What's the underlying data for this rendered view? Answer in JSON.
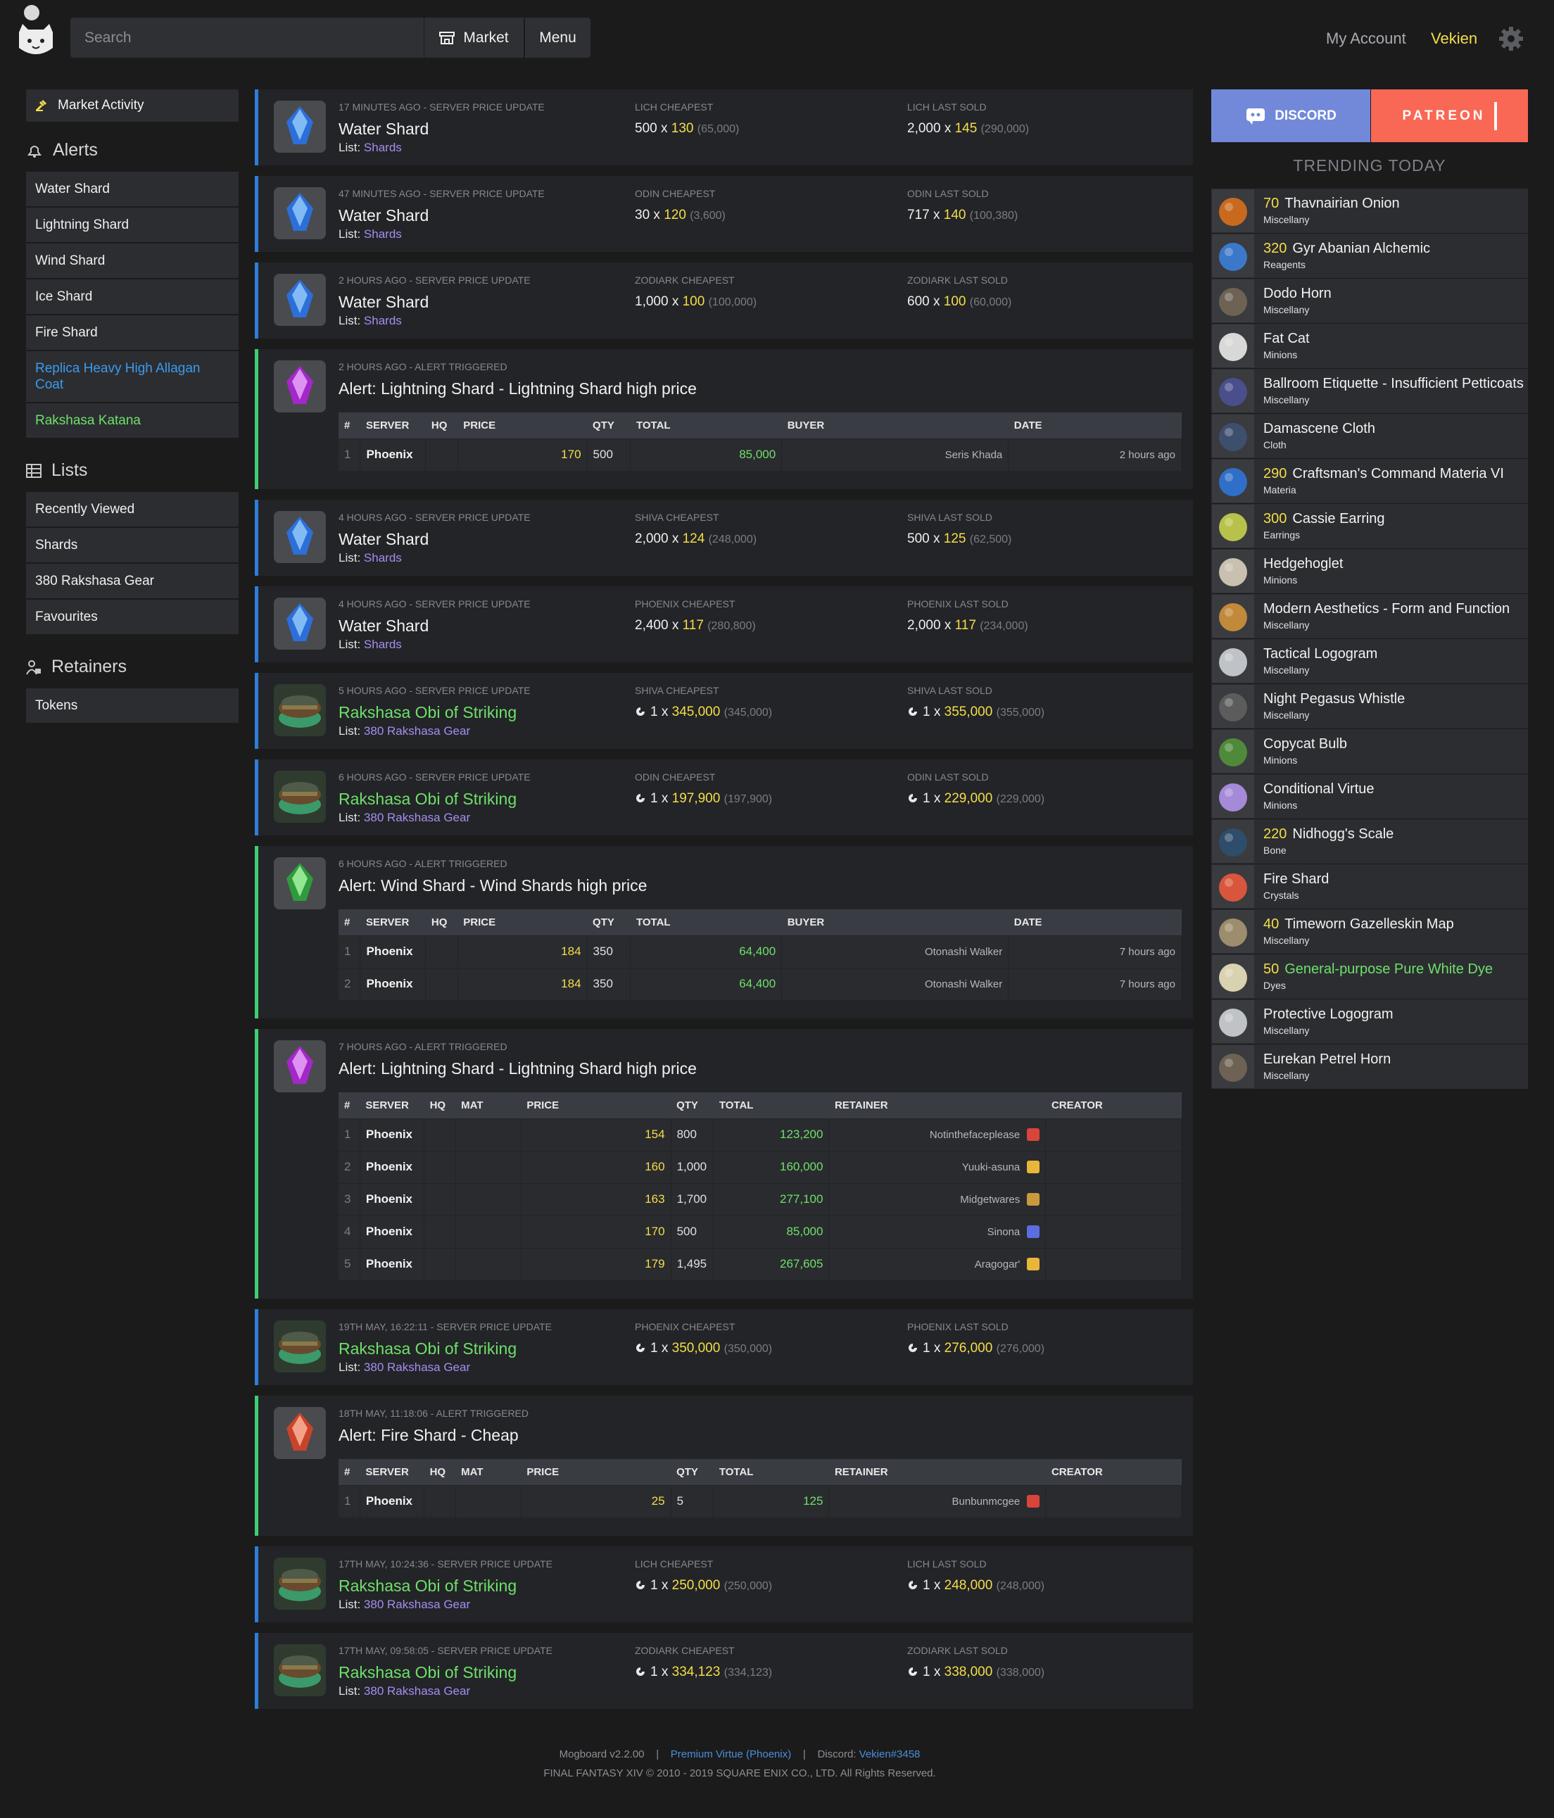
{
  "header": {
    "search_placeholder": "Search",
    "market_label": "Market",
    "menu_label": "Menu",
    "account_label": "My Account",
    "username": "Vekien"
  },
  "sidebar": {
    "market_activity": "Market Activity",
    "alerts_heading": "Alerts",
    "alerts": [
      {
        "label": "Water Shard",
        "color": "#f0f0f0"
      },
      {
        "label": "Lightning Shard",
        "color": "#f0f0f0"
      },
      {
        "label": "Wind Shard",
        "color": "#f0f0f0"
      },
      {
        "label": "Ice Shard",
        "color": "#f0f0f0"
      },
      {
        "label": "Fire Shard",
        "color": "#f0f0f0"
      },
      {
        "label": "Replica Heavy High Allagan Coat",
        "color": "#3a9bf0"
      },
      {
        "label": "Rakshasa Katana",
        "color": "#6ee06b"
      }
    ],
    "lists_heading": "Lists",
    "lists": [
      "Recently Viewed",
      "Shards",
      "380 Rakshasa Gear",
      "Favourites"
    ],
    "retainers_heading": "Retainers",
    "retainers": [
      "Tokens"
    ]
  },
  "feed": [
    {
      "type": "price",
      "icon": "water-shard",
      "meta": "17 MINUTES AGO - SERVER PRICE UPDATE",
      "title": "Water Shard",
      "green": false,
      "list_prefix": "List:",
      "list": "Shards",
      "c1_label": "LICH CHEAPEST",
      "c1_qty": "500",
      "c1_price": "130",
      "c1_total": "(65,000)",
      "c2_label": "LICH LAST SOLD",
      "c2_qty": "2,000",
      "c2_price": "145",
      "c2_total": "(290,000)",
      "hq": false
    },
    {
      "type": "price",
      "icon": "water-shard",
      "meta": "47 MINUTES AGO - SERVER PRICE UPDATE",
      "title": "Water Shard",
      "green": false,
      "list_prefix": "List:",
      "list": "Shards",
      "c1_label": "ODIN CHEAPEST",
      "c1_qty": "30",
      "c1_price": "120",
      "c1_total": "(3,600)",
      "c2_label": "ODIN LAST SOLD",
      "c2_qty": "717",
      "c2_price": "140",
      "c2_total": "(100,380)",
      "hq": false
    },
    {
      "type": "price",
      "icon": "water-shard",
      "meta": "2 HOURS AGO - SERVER PRICE UPDATE",
      "title": "Water Shard",
      "green": false,
      "list_prefix": "List:",
      "list": "Shards",
      "c1_label": "ZODIARK CHEAPEST",
      "c1_qty": "1,000",
      "c1_price": "100",
      "c1_total": "(100,000)",
      "c2_label": "ZODIARK LAST SOLD",
      "c2_qty": "600",
      "c2_price": "100",
      "c2_total": "(60,000)",
      "hq": false
    },
    {
      "type": "alert",
      "icon": "lightning-shard",
      "meta": "2 HOURS AGO - ALERT TRIGGERED",
      "title": "Alert: Lightning Shard - Lightning Shard high price",
      "kind": "sold",
      "headers": [
        "#",
        "SERVER",
        "HQ",
        "PRICE",
        "QTY",
        "TOTAL",
        "BUYER",
        "DATE"
      ],
      "rows": [
        [
          "1",
          "Phoenix",
          "",
          "170",
          "500",
          "85,000",
          "Seris Khada",
          "2 hours ago"
        ]
      ]
    },
    {
      "type": "price",
      "icon": "water-shard",
      "meta": "4 HOURS AGO - SERVER PRICE UPDATE",
      "title": "Water Shard",
      "green": false,
      "list_prefix": "List:",
      "list": "Shards",
      "c1_label": "SHIVA CHEAPEST",
      "c1_qty": "2,000",
      "c1_price": "124",
      "c1_total": "(248,000)",
      "c2_label": "SHIVA LAST SOLD",
      "c2_qty": "500",
      "c2_price": "125",
      "c2_total": "(62,500)",
      "hq": false
    },
    {
      "type": "price",
      "icon": "water-shard",
      "meta": "4 HOURS AGO - SERVER PRICE UPDATE",
      "title": "Water Shard",
      "green": false,
      "list_prefix": "List:",
      "list": "Shards",
      "c1_label": "PHOENIX CHEAPEST",
      "c1_qty": "2,400",
      "c1_price": "117",
      "c1_total": "(280,800)",
      "c2_label": "PHOENIX LAST SOLD",
      "c2_qty": "2,000",
      "c2_price": "117",
      "c2_total": "(234,000)",
      "hq": false
    },
    {
      "type": "price",
      "icon": "rakshasa-obi",
      "meta": "5 HOURS AGO - SERVER PRICE UPDATE",
      "title": "Rakshasa Obi of Striking",
      "green": true,
      "list_prefix": "List:",
      "list": "380 Rakshasa Gear",
      "c1_label": "SHIVA CHEAPEST",
      "c1_qty": "1",
      "c1_price": "345,000",
      "c1_total": "(345,000)",
      "c2_label": "SHIVA LAST SOLD",
      "c2_qty": "1",
      "c2_price": "355,000",
      "c2_total": "(355,000)",
      "hq": true
    },
    {
      "type": "price",
      "icon": "rakshasa-obi",
      "meta": "6 HOURS AGO - SERVER PRICE UPDATE",
      "title": "Rakshasa Obi of Striking",
      "green": true,
      "list_prefix": "List:",
      "list": "380 Rakshasa Gear",
      "c1_label": "ODIN CHEAPEST",
      "c1_qty": "1",
      "c1_price": "197,900",
      "c1_total": "(197,900)",
      "c2_label": "ODIN LAST SOLD",
      "c2_qty": "1",
      "c2_price": "229,000",
      "c2_total": "(229,000)",
      "hq": true
    },
    {
      "type": "alert",
      "icon": "wind-shard",
      "meta": "6 HOURS AGO - ALERT TRIGGERED",
      "title": "Alert: Wind Shard - Wind Shards high price",
      "kind": "sold",
      "headers": [
        "#",
        "SERVER",
        "HQ",
        "PRICE",
        "QTY",
        "TOTAL",
        "BUYER",
        "DATE"
      ],
      "rows": [
        [
          "1",
          "Phoenix",
          "",
          "184",
          "350",
          "64,400",
          "Otonashi Walker",
          "7 hours ago"
        ],
        [
          "2",
          "Phoenix",
          "",
          "184",
          "350",
          "64,400",
          "Otonashi Walker",
          "7 hours ago"
        ]
      ]
    },
    {
      "type": "alert",
      "icon": "lightning-shard",
      "meta": "7 HOURS AGO - ALERT TRIGGERED",
      "title": "Alert: Lightning Shard - Lightning Shard high price",
      "kind": "listing",
      "headers": [
        "#",
        "SERVER",
        "HQ",
        "MAT",
        "PRICE",
        "QTY",
        "TOTAL",
        "RETAINER",
        "CREATOR"
      ],
      "rows": [
        [
          "1",
          "Phoenix",
          "",
          "",
          "154",
          "800",
          "123,200",
          "Notinthefaceplease",
          "#d9453b",
          ""
        ],
        [
          "2",
          "Phoenix",
          "",
          "",
          "160",
          "1,000",
          "160,000",
          "Yuuki-asuna",
          "#e8b73a",
          ""
        ],
        [
          "3",
          "Phoenix",
          "",
          "",
          "163",
          "1,700",
          "277,100",
          "Midgetwares",
          "#c89a3c",
          ""
        ],
        [
          "4",
          "Phoenix",
          "",
          "",
          "170",
          "500",
          "85,000",
          "Sinona",
          "#5b6ee0",
          ""
        ],
        [
          "5",
          "Phoenix",
          "",
          "",
          "179",
          "1,495",
          "267,605",
          "Aragogar'",
          "#e8b73a",
          ""
        ]
      ]
    },
    {
      "type": "price",
      "icon": "rakshasa-obi",
      "meta": "19TH MAY, 16:22:11 - SERVER PRICE UPDATE",
      "title": "Rakshasa Obi of Striking",
      "green": true,
      "list_prefix": "List:",
      "list": "380 Rakshasa Gear",
      "c1_label": "PHOENIX CHEAPEST",
      "c1_qty": "1",
      "c1_price": "350,000",
      "c1_total": "(350,000)",
      "c2_label": "PHOENIX LAST SOLD",
      "c2_qty": "1",
      "c2_price": "276,000",
      "c2_total": "(276,000)",
      "hq": true
    },
    {
      "type": "alert",
      "icon": "fire-shard",
      "meta": "18TH MAY, 11:18:06 - ALERT TRIGGERED",
      "title": "Alert: Fire Shard - Cheap",
      "kind": "listing",
      "headers": [
        "#",
        "SERVER",
        "HQ",
        "MAT",
        "PRICE",
        "QTY",
        "TOTAL",
        "RETAINER",
        "CREATOR"
      ],
      "rows": [
        [
          "1",
          "Phoenix",
          "",
          "",
          "25",
          "5",
          "125",
          "Bunbunmcgee",
          "#d9453b",
          ""
        ]
      ]
    },
    {
      "type": "price",
      "icon": "rakshasa-obi",
      "meta": "17TH MAY, 10:24:36 - SERVER PRICE UPDATE",
      "title": "Rakshasa Obi of Striking",
      "green": true,
      "list_prefix": "List:",
      "list": "380 Rakshasa Gear",
      "c1_label": "LICH CHEAPEST",
      "c1_qty": "1",
      "c1_price": "250,000",
      "c1_total": "(250,000)",
      "c2_label": "LICH LAST SOLD",
      "c2_qty": "1",
      "c2_price": "248,000",
      "c2_total": "(248,000)",
      "hq": true
    },
    {
      "type": "price",
      "icon": "rakshasa-obi",
      "meta": "17TH MAY, 09:58:05 - SERVER PRICE UPDATE",
      "title": "Rakshasa Obi of Striking",
      "green": true,
      "list_prefix": "List:",
      "list": "380 Rakshasa Gear",
      "c1_label": "ZODIARK CHEAPEST",
      "c1_qty": "1",
      "c1_price": "334,123",
      "c1_total": "(334,123)",
      "c2_label": "ZODIARK LAST SOLD",
      "c2_qty": "1",
      "c2_price": "338,000",
      "c2_total": "(338,000)",
      "hq": true
    }
  ],
  "right": {
    "discord_label": "DISCORD",
    "patreon_label": "PATREON",
    "trending_heading": "TRENDING TODAY",
    "trending": [
      {
        "level": "70",
        "name": "Thavnairian Onion",
        "category": "Miscellany",
        "icon_color": "#c86a1e",
        "green": false
      },
      {
        "level": "320",
        "name": "Gyr Abanian Alchemic",
        "category": "Reagents",
        "icon_color": "#3b78c9",
        "green": false
      },
      {
        "level": "",
        "name": "Dodo Horn",
        "category": "Miscellany",
        "icon_color": "#6e6254",
        "green": false
      },
      {
        "level": "",
        "name": "Fat Cat",
        "category": "Minions",
        "icon_color": "#d8d8d8",
        "green": false
      },
      {
        "level": "",
        "name": "Ballroom Etiquette - Insufficient Petticoats",
        "category": "Miscellany",
        "icon_color": "#4a4f8c",
        "green": false
      },
      {
        "level": "",
        "name": "Damascene Cloth",
        "category": "Cloth",
        "icon_color": "#3e4f6e",
        "green": false
      },
      {
        "level": "290",
        "name": "Craftsman's Command Materia VI",
        "category": "Materia",
        "icon_color": "#2f6fc7",
        "green": false
      },
      {
        "level": "300",
        "name": "Cassie Earring",
        "category": "Earrings",
        "icon_color": "#b8c24a",
        "green": false
      },
      {
        "level": "",
        "name": "Hedgehoglet",
        "category": "Minions",
        "icon_color": "#c9c0b0",
        "green": false
      },
      {
        "level": "",
        "name": "Modern Aesthetics - Form and Function",
        "category": "Miscellany",
        "icon_color": "#c08a3a",
        "green": false
      },
      {
        "level": "",
        "name": "Tactical Logogram",
        "category": "Miscellany",
        "icon_color": "#bfc3c8",
        "green": false
      },
      {
        "level": "",
        "name": "Night Pegasus Whistle",
        "category": "Miscellany",
        "icon_color": "#5c5c5c",
        "green": false
      },
      {
        "level": "",
        "name": "Copycat Bulb",
        "category": "Minions",
        "icon_color": "#4f8a3a",
        "green": false
      },
      {
        "level": "",
        "name": "Conditional Virtue",
        "category": "Minions",
        "icon_color": "#a58ad8",
        "green": false
      },
      {
        "level": "220",
        "name": "Nidhogg's Scale",
        "category": "Bone",
        "icon_color": "#2e4d6a",
        "green": false
      },
      {
        "level": "",
        "name": "Fire Shard",
        "category": "Crystals",
        "icon_color": "#d8563c",
        "green": false
      },
      {
        "level": "40",
        "name": "Timeworn Gazelleskin Map",
        "category": "Miscellany",
        "icon_color": "#9c8d6c",
        "green": false
      },
      {
        "level": "50",
        "name": "General-purpose Pure White Dye",
        "category": "Dyes",
        "icon_color": "#d8d2b0",
        "green": true
      },
      {
        "level": "",
        "name": "Protective Logogram",
        "category": "Miscellany",
        "icon_color": "#bfc3c8",
        "green": false
      },
      {
        "level": "",
        "name": "Eurekan Petrel Horn",
        "category": "Miscellany",
        "icon_color": "#6e6254",
        "green": false
      }
    ]
  },
  "footer": {
    "version": "Mogboard v2.2.00",
    "sep": "|",
    "virtue": "Premium Virtue (Phoenix)",
    "discord_prefix": "Discord:",
    "discord": "Vekien#3458",
    "copyright": "FINAL FANTASY XIV © 2010 - 2019 SQUARE ENIX CO., LTD. All Rights Reserved."
  },
  "colors": {
    "accent_blue": "#2d7ed9",
    "accent_green": "#3ecf74",
    "price_yellow": "#f4de4a",
    "discord": "#7289da",
    "patreon": "#f96854"
  }
}
